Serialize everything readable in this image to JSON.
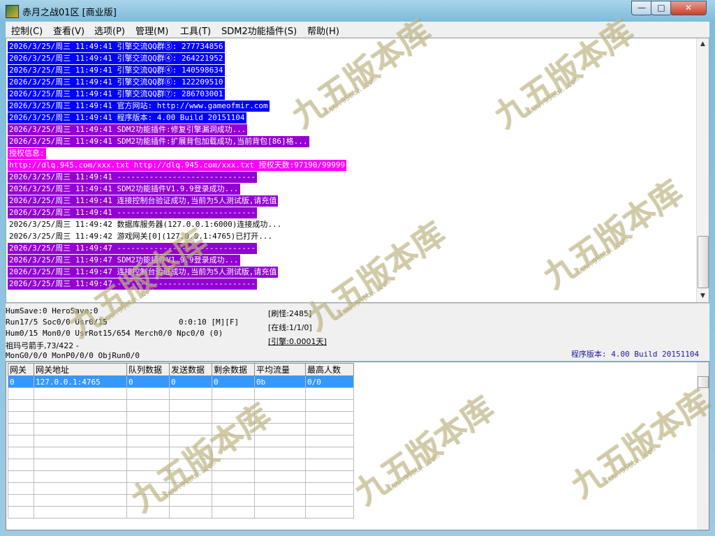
{
  "window": {
    "title": "赤月之战01区 [商业版]",
    "buttons": {
      "minimize": "—",
      "maximize": "□",
      "close": "✕"
    }
  },
  "menu": [
    "控制(C)",
    "查看(V)",
    "选项(P)",
    "管理(M)",
    "工具(T)",
    "SDM2功能插件(S)",
    "帮助(H)"
  ],
  "log": [
    {
      "text": "2026/3/25/周三 11:49:41 引擎交流QQ群⑤: 277734856",
      "style": "blue"
    },
    {
      "text": "2026/3/25/周三 11:49:41 引擎交流QQ群④: 264221952",
      "style": "blue"
    },
    {
      "text": "2026/3/25/周三 11:49:41 引擎交流QQ群④: 140598634",
      "style": "blue"
    },
    {
      "text": "2026/3/25/周三 11:49:41 引擎交流QQ群⑥: 122209510",
      "style": "blue"
    },
    {
      "text": "2026/3/25/周三 11:49:41 引擎交流QQ群⑦: 286703001",
      "style": "blue"
    },
    {
      "text": "2026/3/25/周三 11:49:41 官方网站: http://www.gameofmir.com",
      "style": "blue"
    },
    {
      "text": "2026/3/25/周三 11:49:41 程序版本: 4.00 Build 20151104",
      "style": "blue"
    },
    {
      "text": "2026/3/25/周三 11:49:41 SDM2功能插件:修复引擎漏洞成功...",
      "style": "purple"
    },
    {
      "text": "2026/3/25/周三 11:49:41 SDM2功能插件:扩展背包加载成功,当前背包[86]格...",
      "style": "purple"
    },
    {
      "text": "授权信息:",
      "style": "magenta"
    },
    {
      "text": "http://dlq.945.com/xxx.txt http://dlq.945.com/xxx.txt 授权天数:97190/99999",
      "style": "magenta"
    },
    {
      "text": "2026/3/25/周三 11:49:41 ------------------------------",
      "style": "purple"
    },
    {
      "text": "2026/3/25/周三 11:49:41 SDM2功能插件V1.9.9登录成功...",
      "style": "purple"
    },
    {
      "text": "2026/3/25/周三 11:49:41 连接控制台验证成功,当前为5人测试版,请充值",
      "style": "purple"
    },
    {
      "text": "2026/3/25/周三 11:49:41 ------------------------------",
      "style": "purple"
    },
    {
      "text": "2026/3/25/周三 11:49:42 数据库服务器(127.0.0.1:6000)连接成功...",
      "style": "plain"
    },
    {
      "text": "2026/3/25/周三 11:49:42 游戏网关[0](127.0.0.1:4765)已打开...",
      "style": "plain"
    },
    {
      "text": "2026/3/25/周三 11:49:47 ------------------------------",
      "style": "purple"
    },
    {
      "text": "2026/3/25/周三 11:49:47 SDM2功能插件V1.9.9登录成功...",
      "style": "purple"
    },
    {
      "text": "2026/3/25/周三 11:49:47 连接控制台验证成功,当前为5人测试版,请充值",
      "style": "purple"
    },
    {
      "text": "2026/3/25/周三 11:49:47 ------------------------------",
      "style": "purple"
    }
  ],
  "status": {
    "line1": "HumSave:0 HeroSave:0",
    "line2": "Run17/5 Soc0/0 Usr0/15",
    "time": "0:0:10 [M][F]",
    "line3": "Hum0/15 Mon0/0 UsrRot15/654 Merch0/0 Npc0/0 (0)",
    "line4": "祖玛弓箭手,73/422 -",
    "line5": "MonG0/0/0 MonP0/0/0 ObjRun0/0",
    "refresh": "[刷怪:2485]",
    "online": "[在线:1/1/0]",
    "engine": "[引擎:0.0001天]",
    "version": "程序版本: 4.00 Build 20151104"
  },
  "grid": {
    "columns": [
      "网关",
      "网关地址",
      "队列数据",
      "发送数据",
      "剩余数据",
      "平均流量",
      "最高人数"
    ],
    "rows": [
      [
        "0",
        "127.0.0.1:4765",
        "0",
        "0",
        "0",
        "0b",
        "0/0"
      ]
    ]
  },
  "watermark": {
    "brand": "九五版本库",
    "url": "www.95bbk.com"
  }
}
